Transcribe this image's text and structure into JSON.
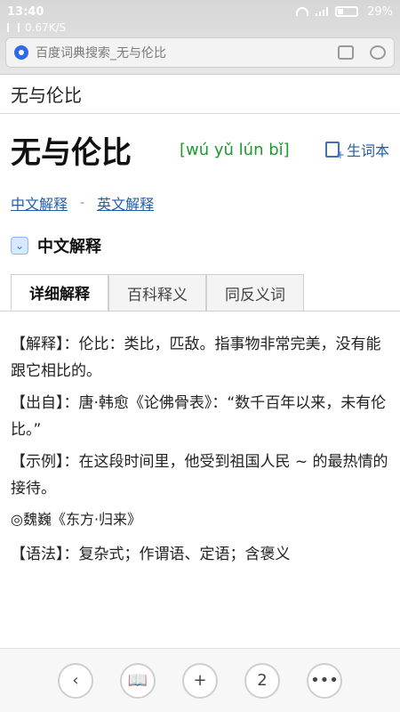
{
  "status_bar": {
    "time": "13:40",
    "network_speed": "0.67K/S",
    "battery_percent": "29%",
    "battery_level": 0.29
  },
  "browser": {
    "tab_title": "百度词典搜索_无与伦比"
  },
  "search": {
    "query": "无与伦比"
  },
  "entry": {
    "title": "无与伦比",
    "pinyin": "[wú yǔ lún bǐ]",
    "vocab_label": "生词本",
    "links": [
      "中文解释",
      "英文解释"
    ],
    "link_separator": "-",
    "section_title": "中文解释",
    "tabs": [
      "详细解释",
      "百科释义",
      "同反义词"
    ],
    "definitions": [
      "【解释】：伦比：类比，匹敌。指事物非常完美，没有能跟它相比的。",
      "【出自】：唐·韩愈《论佛骨表》：“数千百年以来，未有伦比。”",
      "【示例】：在这段时间里，他受到祖国人民 ~ 的最热情的接待。"
    ],
    "example_source": "◎魏巍《东方·归来》",
    "grammar": "【语法】：复杂式；作谓语、定语；含褒义"
  },
  "bottom_nav": {
    "back_icon": "‹",
    "bookmark_icon": "📖",
    "add_icon": "+",
    "tab_count": "2",
    "more_icon": "•••"
  }
}
